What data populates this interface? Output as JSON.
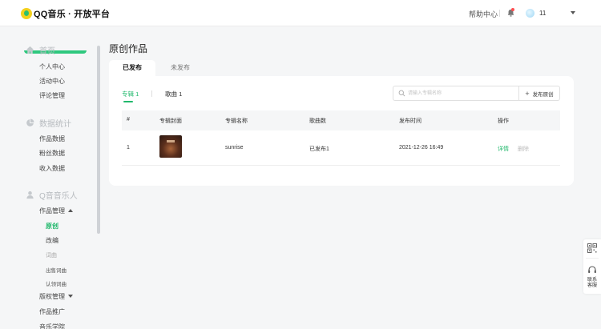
{
  "header": {
    "logo_text": "QQ音乐 · 开放平台",
    "help_label": "帮助中心",
    "username": "11"
  },
  "sidebar": {
    "sections": [
      {
        "label": "首页",
        "icon": "home-icon"
      },
      {
        "label": "数据统计",
        "icon": "pie-chart-icon"
      },
      {
        "label": "Q音音乐人",
        "icon": "user-icon"
      }
    ],
    "home_items": [
      "个人中心",
      "活动中心",
      "评论管理"
    ],
    "stats_items": [
      "作品数据",
      "粉丝数据",
      "收入数据"
    ],
    "musician": {
      "works_manage": "作品管理",
      "original": "原创",
      "cover": "改编",
      "lyrics": "词曲",
      "sell_lyrics": "出售词曲",
      "claim_lyrics": "认领词曲",
      "copyright_manage": "版权管理",
      "promotion": "作品推广",
      "academy": "音乐学院"
    }
  },
  "main": {
    "title": "原创作品",
    "tabs": {
      "published": "已发布",
      "unpublished": "未发布"
    },
    "subtabs": {
      "album": "专辑 1",
      "song": "歌曲 1"
    },
    "search": {
      "placeholder": "请输入专辑名称"
    },
    "publish_button": "发布原创",
    "table": {
      "headers": [
        "#",
        "专辑封面",
        "专辑名称",
        "歌曲数",
        "发布时间",
        "操作"
      ],
      "rows": [
        {
          "index": "1",
          "name": "sunrise",
          "songs": "已发布1",
          "date": "2021-12-26 16:49",
          "detail": "详情",
          "delete": "删除"
        }
      ]
    }
  },
  "float": {
    "contact": "联系客服"
  },
  "colors": {
    "accent": "#21b86c",
    "background": "#f5f6f7"
  }
}
